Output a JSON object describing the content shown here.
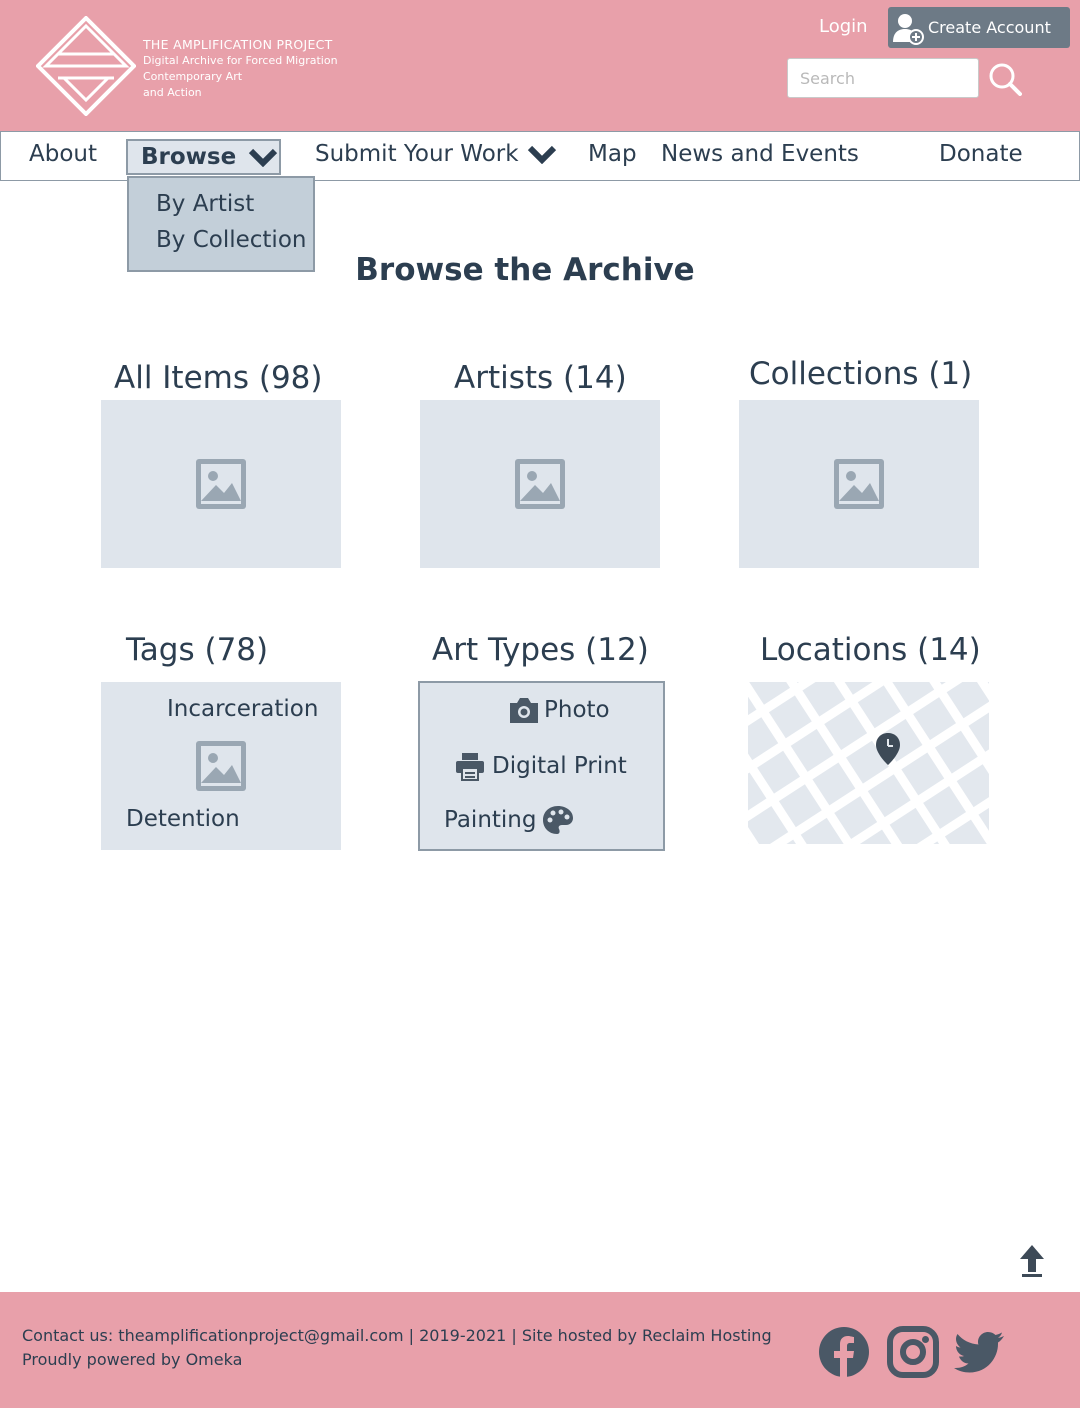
{
  "header": {
    "logo_line1": "THE AMPLIFICATION PROJECT",
    "logo_line2": "Digital Archive for Forced Migration",
    "logo_line3": "Contemporary Art",
    "logo_line4": "and Action",
    "login_label": "Login",
    "create_account_label": "Create Account",
    "search_placeholder": "Search"
  },
  "nav": {
    "items": [
      {
        "label": "About"
      },
      {
        "label": "Browse"
      },
      {
        "label": "Submit Your Work"
      },
      {
        "label": "Map"
      },
      {
        "label": "News and Events"
      },
      {
        "label": "Donate"
      }
    ],
    "browse_dropdown": [
      "By Artist",
      "By Collection"
    ]
  },
  "main": {
    "title": "Browse the Archive",
    "cards": [
      {
        "label": "All Items (98)",
        "icon": "image-placeholder-icon"
      },
      {
        "label": "Artists (14)",
        "icon": "image-placeholder-icon"
      },
      {
        "label": "Collections (1)",
        "icon": "image-placeholder-icon"
      },
      {
        "label": "Tags (78)"
      },
      {
        "label": "Art Types (12)"
      },
      {
        "label": "Locations (14)"
      }
    ],
    "tags_preview": [
      "Incarceration",
      "Detention"
    ],
    "art_types_preview": [
      {
        "label": "Photo",
        "icon": "camera-icon"
      },
      {
        "label": "Digital Print",
        "icon": "printer-icon"
      },
      {
        "label": "Painting",
        "icon": "palette-icon"
      }
    ]
  },
  "footer": {
    "line1": "Contact us: theamplificationproject@gmail.com | 2019-2021 | Site hosted by Reclaim Hosting",
    "line2": "Proudly powered by Omeka",
    "social_icons": [
      "facebook-icon",
      "instagram-icon",
      "twitter-icon"
    ]
  },
  "colors": {
    "header_bg": "#e8a0aa",
    "text_dark": "#2c3e50",
    "placeholder_bg": "#dfe5ec",
    "button_gray": "#6d7a86"
  }
}
